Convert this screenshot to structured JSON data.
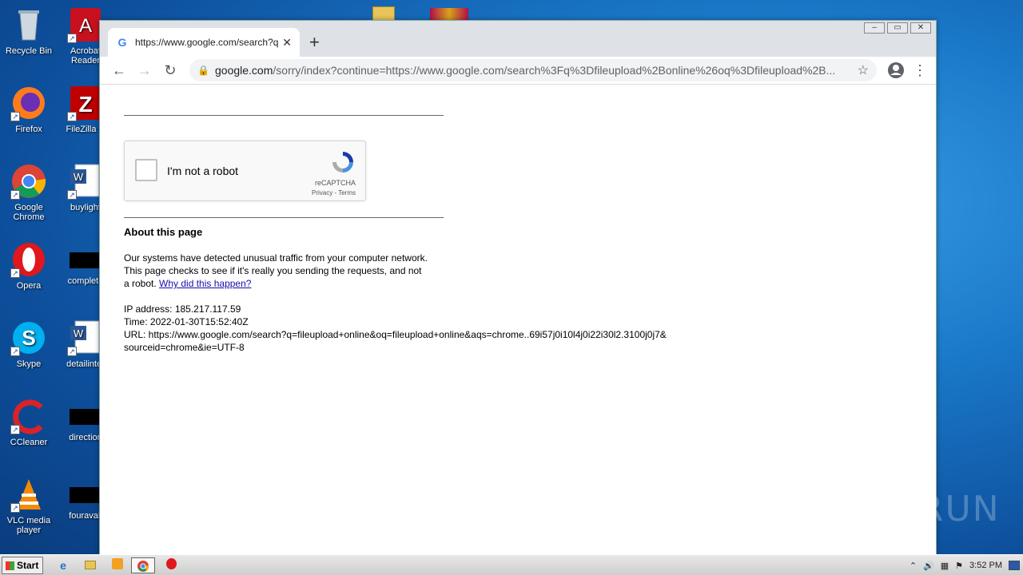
{
  "desktop": {
    "icons_left": [
      {
        "label": "Recycle Bin",
        "icon": "recycle-bin-icon"
      },
      {
        "label": "Firefox",
        "icon": "firefox-icon"
      },
      {
        "label": "Google Chrome",
        "icon": "chrome-icon"
      },
      {
        "label": "Opera",
        "icon": "opera-icon"
      },
      {
        "label": "Skype",
        "icon": "skype-icon"
      },
      {
        "label": "CCleaner",
        "icon": "ccleaner-icon"
      },
      {
        "label": "VLC media player",
        "icon": "vlc-icon"
      }
    ],
    "icons_right": [
      {
        "label": "Acrobat Reader",
        "icon": "acrobat-icon"
      },
      {
        "label": "FileZilla C",
        "icon": "filezilla-icon"
      },
      {
        "label": "buylight",
        "icon": "word-doc-icon"
      },
      {
        "label": "complete",
        "icon": "black-file-icon"
      },
      {
        "label": "detailinter",
        "icon": "word-doc-icon"
      },
      {
        "label": "direction",
        "icon": "black-file-icon"
      },
      {
        "label": "fouravail",
        "icon": "black-file-icon"
      }
    ]
  },
  "browser": {
    "tab": {
      "title": "https://www.google.com/search?q=",
      "close": "✕"
    },
    "new_tab": "+",
    "window_controls": [
      "‒",
      "▭",
      "✕"
    ],
    "address": {
      "host": "google.com",
      "path": "/sorry/index?continue=https://www.google.com/search%3Fq%3Dfileupload%2Bonline%26oq%3Dfileupload%2B..."
    }
  },
  "page": {
    "captcha": {
      "label": "I'm not a robot",
      "brand": "reCAPTCHA",
      "terms": "Privacy - Terms"
    },
    "about_title": "About this page",
    "paragraph": "Our systems have detected unusual traffic from your computer network. This page checks to see if it's really you sending the requests, and not a robot. ",
    "link": "Why did this happen?",
    "ip": "IP address: 185.217.117.59",
    "time": "Time: 2022-01-30T15:52:40Z",
    "url": "URL: https://www.google.com/search?q=fileupload+online&oq=fileupload+online&aqs=chrome..69i57j0i10l4j0i22i30l2.3100j0j7&sourceid=chrome&ie=UTF-8"
  },
  "taskbar": {
    "start": "Start",
    "clock": "3:52 PM"
  },
  "watermark": "ANY RUN"
}
